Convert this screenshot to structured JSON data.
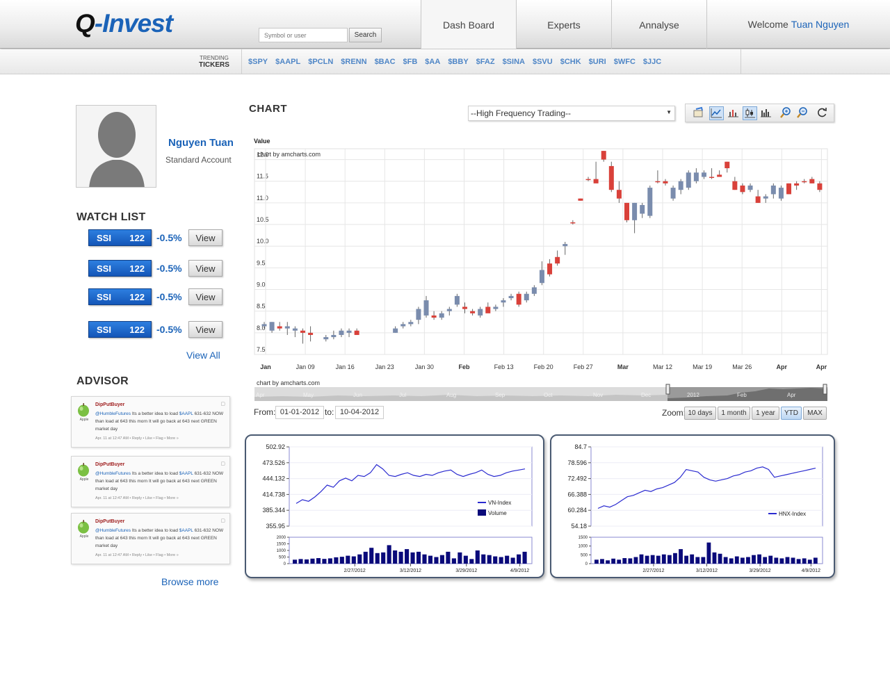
{
  "header": {
    "logo_q": "Q",
    "logo_rest": "-Invest",
    "search_placeholder": "Symbol or user",
    "search_button": "Search",
    "tabs": [
      {
        "label": "Dash Board"
      },
      {
        "label": "Experts"
      },
      {
        "label": "Annalyse"
      }
    ],
    "welcome_prefix": "Welcome",
    "welcome_user": "Tuan Nguyen"
  },
  "tickers": {
    "label_line1": "TRENDING",
    "label_line2": "TICKERS",
    "items": [
      "$SPY",
      "$AAPL",
      "$PCLN",
      "$RENN",
      "$BAC",
      "$FB",
      "$AA",
      "$BBY",
      "$FAZ",
      "$SINA",
      "$SVU",
      "$CHK",
      "$URI",
      "$WFC",
      "$JJC"
    ]
  },
  "profile": {
    "name": "Nguyen Tuan",
    "account_type": "Standard Account"
  },
  "watchlist": {
    "title": "WATCH LIST",
    "items": [
      {
        "symbol": "SSI",
        "value": "122",
        "change": "-0.5%",
        "action": "View"
      },
      {
        "symbol": "SSI",
        "value": "122",
        "change": "-0.5%",
        "action": "View"
      },
      {
        "symbol": "SSI",
        "value": "122",
        "change": "-0.5%",
        "action": "View"
      },
      {
        "symbol": "SSI",
        "value": "122",
        "change": "-0.5%",
        "action": "View"
      }
    ],
    "view_all": "View All"
  },
  "advisor": {
    "title": "ADVISOR",
    "posts": [
      {
        "apple_label": "Apple",
        "user": "DipPutBuyer",
        "handle": "@HumbleFutures",
        "text_a": " Its a better idea to load ",
        "ticker": "$AAPL",
        "text_b": " 631-632 NOW than load at 643 this morn It will go back at 643 next GREEN market day",
        "meta": "Apr. 11 at 12:47 AM • Reply • Like • Flag • More »"
      },
      {
        "apple_label": "Apple",
        "user": "DipPutBuyer",
        "handle": "@HumbleFutures",
        "text_a": " Its a better idea to load ",
        "ticker": "$AAPL",
        "text_b": " 631-632 NOW than load at 643 this morn It will go back at 643 next GREEN market day",
        "meta": "Apr. 11 at 12:47 AM • Reply • Like • Flag • More »"
      },
      {
        "apple_label": "Apple",
        "user": "DipPutBuyer",
        "handle": "@HumbleFutures",
        "text_a": " Its a better idea to load ",
        "ticker": "$AAPL",
        "text_b": " 631-632 NOW than load at 643 this morn It will go back at 643 next GREEN market day",
        "meta": "Apr. 11 at 12:47 AM • Reply • Like • Flag • More »"
      }
    ],
    "browse_more": "Browse more"
  },
  "chart_panel": {
    "title": "CHART",
    "strategy_selected": "--High Frequency Trading--",
    "toolbar_icons": [
      "settings-icon",
      "line-chart-icon",
      "column-chart-icon",
      "candlestick-icon",
      "histogram-icon",
      "zoom-in-icon",
      "zoom-out-icon",
      "refresh-icon"
    ],
    "from_label": "From:",
    "from_value": "01-01-2012",
    "to_label": "to:",
    "to_value": "10-04-2012",
    "zoom_label": "Zoom:",
    "zoom_options": [
      "10 days",
      "1 month",
      "1 year",
      "YTD",
      "MAX"
    ],
    "zoom_selected": "YTD",
    "scroller_credit": "chart by amcharts.com",
    "scroller_months": [
      "Apr",
      "May",
      "Jun",
      "Jul",
      "Aug",
      "Sep",
      "Oct",
      "Nov",
      "Dec",
      "2012",
      "Feb",
      "Apr"
    ]
  },
  "colors": {
    "accent": "#1b63b8",
    "up": "#d9413a",
    "down": "#7a8cad",
    "mini_line": "#2b2bd0",
    "mini_bar": "#0a0a7a"
  },
  "chart_data": [
    {
      "type": "candlestick",
      "ylabel": "Value",
      "credit": "chart by amcharts.com",
      "ylim": [
        7.5,
        12.25
      ],
      "yticks": [
        7.5,
        8.0,
        8.5,
        9.0,
        9.5,
        10.0,
        10.5,
        11.0,
        11.5,
        12.0
      ],
      "xticks": [
        "Jan",
        "Jan 09",
        "Jan 16",
        "Jan 23",
        "Jan 30",
        "Feb",
        "Feb 13",
        "Feb 20",
        "Feb 27",
        "Mar",
        "Mar 12",
        "Mar 19",
        "Mar 26",
        "Apr",
        "Apr"
      ],
      "bold_xticks": [
        "Jan",
        "Feb",
        "Mar",
        "Apr"
      ],
      "candles": [
        [
          0,
          8.15,
          8.25,
          8.1,
          8.2
        ],
        [
          1,
          8.05,
          8.25,
          8.0,
          8.25
        ],
        [
          2,
          8.15,
          8.25,
          8.05,
          8.1
        ],
        [
          3,
          8.1,
          8.25,
          7.95,
          8.15
        ],
        [
          4,
          8.05,
          8.15,
          7.9,
          8.1
        ],
        [
          5,
          8.05,
          8.1,
          7.75,
          8.0
        ],
        [
          6,
          8.0,
          8.15,
          7.8,
          7.95
        ],
        [
          8,
          7.85,
          7.95,
          7.8,
          7.9
        ],
        [
          9,
          7.9,
          8.05,
          7.85,
          7.95
        ],
        [
          10,
          7.95,
          8.1,
          7.9,
          8.05
        ],
        [
          11,
          8.0,
          8.1,
          7.9,
          8.05
        ],
        [
          12,
          8.05,
          8.1,
          7.95,
          7.95
        ],
        [
          17,
          8.0,
          8.15,
          8.0,
          8.1
        ],
        [
          18,
          8.15,
          8.25,
          8.1,
          8.2
        ],
        [
          19,
          8.2,
          8.3,
          8.15,
          8.25
        ],
        [
          20,
          8.3,
          8.6,
          8.2,
          8.55
        ],
        [
          21,
          8.4,
          8.85,
          8.35,
          8.75
        ],
        [
          22,
          8.4,
          8.5,
          8.3,
          8.35
        ],
        [
          23,
          8.35,
          8.5,
          8.3,
          8.45
        ],
        [
          24,
          8.5,
          8.6,
          8.4,
          8.55
        ],
        [
          25,
          8.65,
          8.9,
          8.6,
          8.85
        ],
        [
          26,
          8.6,
          8.7,
          8.45,
          8.55
        ],
        [
          27,
          8.5,
          8.55,
          8.4,
          8.45
        ],
        [
          28,
          8.4,
          8.6,
          8.35,
          8.55
        ],
        [
          29,
          8.6,
          8.7,
          8.5,
          8.45
        ],
        [
          30,
          8.55,
          8.65,
          8.5,
          8.6
        ],
        [
          31,
          8.7,
          8.8,
          8.6,
          8.75
        ],
        [
          32,
          8.8,
          8.9,
          8.75,
          8.85
        ],
        [
          33,
          8.9,
          8.95,
          8.6,
          8.65
        ],
        [
          34,
          8.75,
          8.95,
          8.7,
          8.9
        ],
        [
          35,
          8.9,
          9.1,
          8.85,
          9.05
        ],
        [
          36,
          9.15,
          9.65,
          9.1,
          9.45
        ],
        [
          37,
          9.6,
          9.7,
          9.3,
          9.35
        ],
        [
          38,
          9.75,
          9.9,
          9.55,
          9.6
        ],
        [
          39,
          10.0,
          10.1,
          9.8,
          10.05
        ],
        [
          40,
          10.55,
          10.6,
          10.5,
          10.55
        ],
        [
          41,
          11.1,
          11.1,
          11.05,
          11.05
        ],
        [
          42,
          11.55,
          11.6,
          11.5,
          11.55
        ],
        [
          43,
          11.55,
          11.95,
          11.5,
          11.45
        ],
        [
          44,
          12.2,
          12.2,
          11.95,
          12.0
        ],
        [
          45,
          11.85,
          11.95,
          11.25,
          11.3
        ],
        [
          46,
          11.3,
          11.5,
          11.0,
          11.1
        ],
        [
          47,
          11.0,
          11.0,
          10.55,
          10.6
        ],
        [
          48,
          10.6,
          11.0,
          10.3,
          11.0
        ],
        [
          49,
          10.75,
          11.0,
          10.65,
          10.95
        ],
        [
          50,
          10.7,
          11.4,
          10.65,
          11.35
        ],
        [
          51,
          11.5,
          11.75,
          11.45,
          11.5
        ],
        [
          52,
          11.5,
          11.55,
          11.4,
          11.45
        ],
        [
          53,
          11.1,
          11.4,
          11.05,
          11.35
        ],
        [
          54,
          11.3,
          11.55,
          11.2,
          11.5
        ],
        [
          55,
          11.35,
          11.75,
          11.3,
          11.7
        ],
        [
          56,
          11.5,
          11.8,
          11.45,
          11.7
        ],
        [
          57,
          11.6,
          11.75,
          11.55,
          11.7
        ],
        [
          58,
          11.6,
          11.8,
          11.55,
          11.6
        ],
        [
          59,
          11.65,
          11.75,
          11.6,
          11.6
        ],
        [
          60,
          11.95,
          11.95,
          11.7,
          11.8
        ],
        [
          61,
          11.5,
          11.6,
          11.3,
          11.3
        ],
        [
          62,
          11.4,
          11.45,
          11.2,
          11.25
        ],
        [
          63,
          11.3,
          11.45,
          11.25,
          11.4
        ],
        [
          64,
          11.15,
          11.3,
          11.0,
          11.0
        ],
        [
          65,
          11.1,
          11.2,
          11.0,
          11.15
        ],
        [
          66,
          11.2,
          11.45,
          11.1,
          11.4
        ],
        [
          67,
          11.1,
          11.4,
          11.05,
          11.35
        ],
        [
          68,
          11.45,
          11.45,
          11.2,
          11.2
        ],
        [
          69,
          11.45,
          11.5,
          11.3,
          11.4
        ],
        [
          70,
          11.5,
          11.55,
          11.45,
          11.5
        ],
        [
          71,
          11.55,
          11.6,
          11.45,
          11.45
        ],
        [
          72,
          11.45,
          11.5,
          11.25,
          11.3
        ]
      ]
    },
    {
      "type": "line",
      "series": [
        {
          "name": "VN-Index",
          "values": [
            398,
            405,
            402,
            410,
            420,
            432,
            428,
            440,
            445,
            440,
            450,
            448,
            455,
            470,
            462,
            450,
            448,
            452,
            455,
            450,
            448,
            452,
            450,
            455,
            458,
            460,
            452,
            448,
            452,
            455,
            460,
            452,
            448,
            450,
            455,
            458,
            460,
            462
          ]
        }
      ],
      "ylim": [
        355.95,
        502.92
      ],
      "yticks": [
        "502.92",
        "473.526",
        "444.132",
        "414.738",
        "385.344",
        "355.95"
      ],
      "volume": {
        "name": "Volume",
        "yticks": [
          "2000",
          "1500",
          "1000",
          "500",
          "0"
        ],
        "ylim": [
          0,
          2000
        ],
        "values": [
          300,
          350,
          320,
          380,
          420,
          360,
          400,
          480,
          520,
          600,
          550,
          700,
          900,
          1200,
          800,
          850,
          1400,
          1000,
          900,
          1100,
          850,
          900,
          700,
          600,
          500,
          650,
          900,
          400,
          850,
          600,
          350,
          1000,
          700,
          650,
          550,
          500,
          600,
          450,
          700,
          900
        ]
      },
      "xticks": [
        "2/27/2012",
        "3/12/2012",
        "3/29/2012",
        "4/9/2012"
      ]
    },
    {
      "type": "line",
      "series": [
        {
          "name": "HNX-Index",
          "values": [
            61,
            62,
            61.5,
            62.5,
            64,
            65.5,
            66,
            67,
            68,
            67.5,
            68.5,
            69,
            70,
            71,
            73,
            76,
            75.5,
            75,
            73,
            72,
            71.5,
            72,
            72.5,
            73.5,
            74,
            75,
            75.5,
            76.5,
            77,
            76,
            73,
            73.5,
            74,
            74.5,
            75,
            75.5,
            76,
            76.5
          ]
        }
      ],
      "ylim": [
        54.18,
        84.7
      ],
      "yticks": [
        "84.7",
        "78.596",
        "72.492",
        "66.388",
        "60.284",
        "54.18"
      ],
      "volume": {
        "yticks": [
          "1500",
          "1000",
          "500",
          "0"
        ],
        "ylim": [
          0,
          2000
        ],
        "values": [
          300,
          350,
          250,
          380,
          300,
          420,
          400,
          500,
          700,
          600,
          650,
          600,
          700,
          650,
          800,
          1100,
          600,
          700,
          500,
          500,
          1600,
          850,
          750,
          500,
          400,
          550,
          450,
          500,
          650,
          700,
          500,
          600,
          450,
          400,
          500,
          450,
          350,
          400,
          300,
          450
        ]
      },
      "xticks": [
        "2/27/2012",
        "3/12/2012",
        "3/29/2012",
        "4/9/2012"
      ]
    }
  ]
}
